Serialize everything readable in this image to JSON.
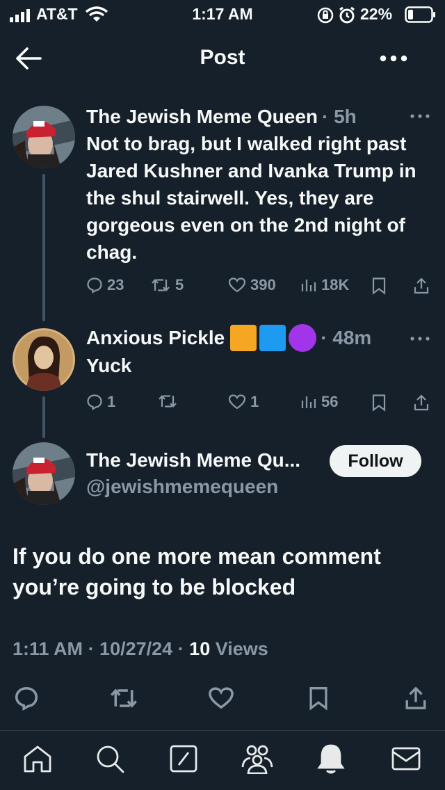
{
  "status_bar": {
    "carrier": "AT&T",
    "time": "1:17 AM",
    "battery": "22%"
  },
  "header": {
    "title": "Post",
    "back_icon": "arrow-left-icon",
    "more_icon": "more-horizontal-icon"
  },
  "tweets": [
    {
      "author": "The Jewish Meme Queen",
      "time": "· 5h",
      "text": "Not to brag, but I walked right past Jared Kushner and Ivanka Trump in the shul stairwell. Yes, they are gorgeous even on the 2nd night of chag.",
      "replies": "23",
      "retweets": "5",
      "likes": "390",
      "views": "18K"
    },
    {
      "author": "Anxious Pickle",
      "badges": [
        "#f5a623",
        "#1d9bf0",
        "#a235e9"
      ],
      "time": "· 48m",
      "text": "Yuck",
      "replies": "1",
      "retweets": "",
      "likes": "1",
      "views": "56"
    }
  ],
  "main_post": {
    "author": "The Jewish Meme Qu...",
    "handle": "@jewishmemequeen",
    "follow_label": "Follow",
    "text": "If you do one more mean comment you’re going to be blocked",
    "time": "1:11 AM",
    "date": "· 10/27/24 ·",
    "views_count": "10",
    "views_label": "Views"
  },
  "nav": [
    "home-icon",
    "search-icon",
    "grok-icon",
    "communities-icon",
    "notifications-icon",
    "messages-icon"
  ]
}
